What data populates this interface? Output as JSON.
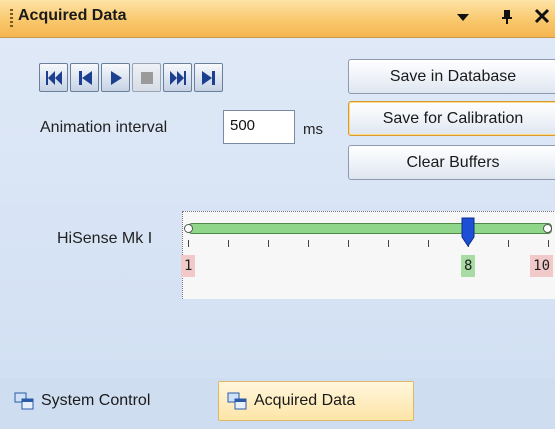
{
  "panel": {
    "title": "Acquired Data",
    "dropdown_icon": "dropdown-arrow-icon",
    "pin_icon": "pin-icon",
    "close_icon": "close-icon"
  },
  "playback": {
    "buttons": [
      {
        "name": "first-frame-button",
        "icon": "skip-to-first-icon",
        "enabled": true
      },
      {
        "name": "previous-frame-button",
        "icon": "step-back-icon",
        "enabled": true
      },
      {
        "name": "play-button",
        "icon": "play-icon",
        "enabled": true
      },
      {
        "name": "stop-button",
        "icon": "stop-icon",
        "enabled": false
      },
      {
        "name": "next-frame-button",
        "icon": "step-forward-icon",
        "enabled": true
      },
      {
        "name": "last-frame-button",
        "icon": "skip-to-last-icon",
        "enabled": true
      }
    ]
  },
  "animation": {
    "label": "Animation interval",
    "value": "500",
    "unit": "ms"
  },
  "actions": {
    "save_database": "Save in Database",
    "save_calibration": "Save for Calibration",
    "clear_buffers": "Clear Buffers"
  },
  "slider": {
    "label": "HiSense Mk I",
    "min": 1,
    "max": 10,
    "value": 8,
    "min_label": "1",
    "max_label": "10",
    "value_label": "8"
  },
  "tabs": [
    {
      "label": "System Control",
      "active": false
    },
    {
      "label": "Acquired Data",
      "active": true
    }
  ],
  "colors": {
    "titlebar": "#f9c86d",
    "track": "#8fd58a",
    "thumb": "#1d4fd6",
    "min_max_badge": "#f1c9c9",
    "value_badge": "#a9dca4"
  }
}
